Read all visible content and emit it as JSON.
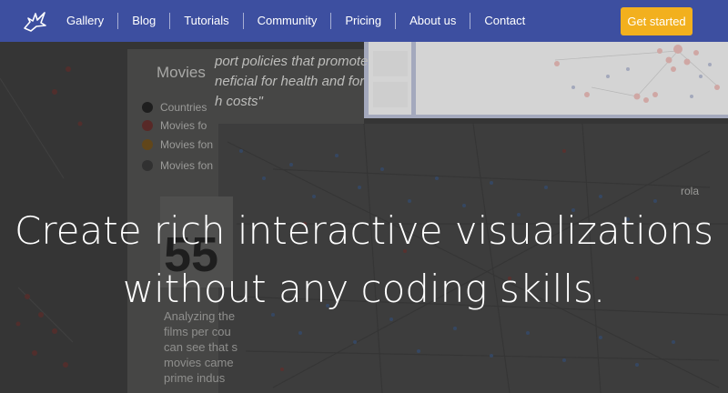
{
  "nav": {
    "logo_icon": "bird-logo-icon",
    "items": [
      {
        "label": "Gallery"
      },
      {
        "label": "Blog"
      },
      {
        "label": "Tutorials"
      },
      {
        "label": "Community"
      },
      {
        "label": "Pricing"
      },
      {
        "label": "About us"
      },
      {
        "label": "Contact"
      }
    ],
    "cta_label": "Get started"
  },
  "hero": {
    "headline_line1": "Create rich interactive visualizations",
    "headline_line2": "without any coding skills.",
    "background": {
      "legend_title": "Movies",
      "quote_line1": "port policies that promote",
      "quote_line2": "neficial for health and for",
      "quote_line3": "h costs\"",
      "legend_items": [
        {
          "label": "Countries",
          "color": "#111111"
        },
        {
          "label": "Movies fo",
          "color": "#b3261e"
        },
        {
          "label": "Movies fon",
          "color": "#d98a00"
        },
        {
          "label": "Movies fon",
          "color": "#555555"
        }
      ],
      "big_number": "55",
      "body_lines": [
        "Analyzing the",
        "films per cou",
        "can see that s",
        "movies came",
        "prime indus"
      ],
      "map_label": "rola"
    }
  },
  "colors": {
    "nav_bg": "#3d4fa0",
    "cta_bg": "#f2b01e",
    "overlay": "#2e2e2e"
  }
}
